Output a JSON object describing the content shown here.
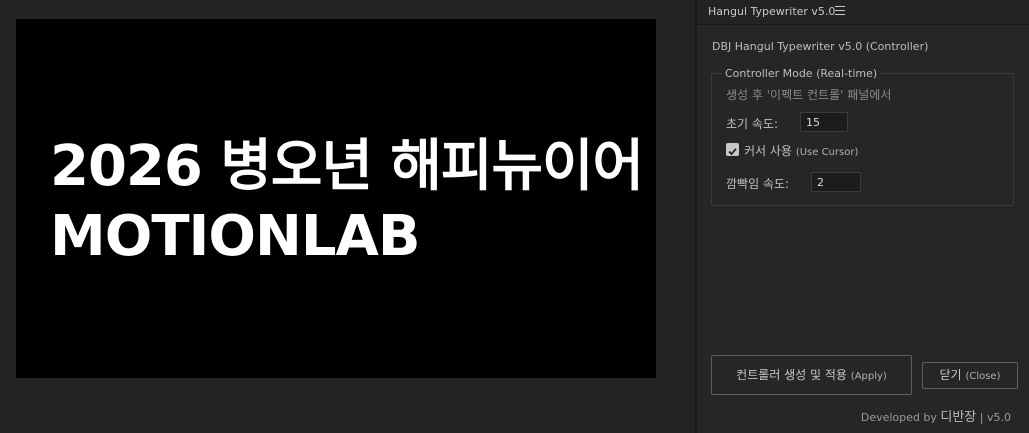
{
  "viewer": {
    "lines": [
      "2026 병오년 해피뉴이어",
      "MOTIONLAB"
    ]
  },
  "panel": {
    "tab_title": "Hangul Typewriter v5.0",
    "heading": "DBJ Hangul Typewriter v5.0 (Controller)",
    "group": {
      "legend": "Controller Mode (Real-time)",
      "hint": "생성 후 '이펙트 컨트롤' 패널에서",
      "initial_speed_label": "초기 속도:",
      "initial_speed_value": "15",
      "use_cursor_label": "커서 사용",
      "use_cursor_sub": "(Use Cursor)",
      "use_cursor_checked": true,
      "blink_speed_label": "깜빡임 속도:",
      "blink_speed_value": "2"
    },
    "apply_button": "컨트롤러 생성 및 적용",
    "apply_button_sub": "(Apply)",
    "close_button": "닫기",
    "close_button_sub": "(Close)",
    "footer_prefix": "Developed by",
    "footer_author": "디반장",
    "footer_version": "| v5.0"
  },
  "colors": {
    "background": "#232323",
    "canvas": "#000000",
    "text_primary": "#c8c8c8"
  }
}
